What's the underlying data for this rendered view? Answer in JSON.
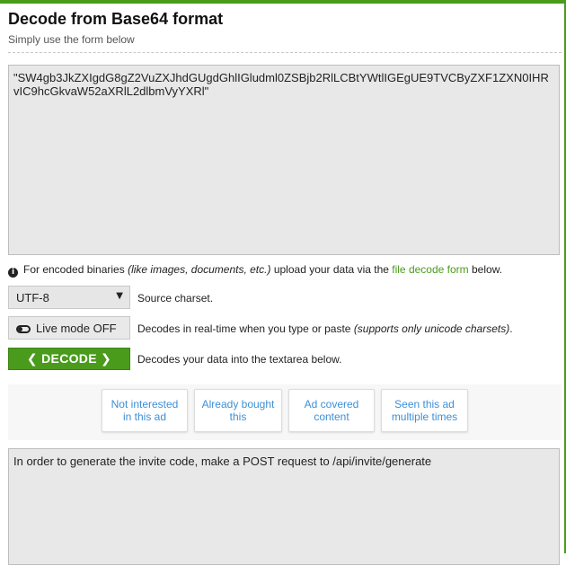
{
  "header": {
    "title": "Decode from Base64 format",
    "subtitle": "Simply use the form below"
  },
  "input": {
    "value": "\"SW4gb3JkZXIgdG8gZ2VuZXJhdGUgdGhlIGludml0ZSBjb2RlLCBtYWtlIGEgUE9TVCByZXF1ZXN0IHRvIC9hcGkvaW52aXRlL2dlbmVyYXRl\""
  },
  "info": {
    "icon": "info-icon",
    "prefix": "For encoded binaries",
    "examples": "(like images, documents, etc.)",
    "middle": "upload your data via the",
    "link": "file decode form",
    "suffix": "below."
  },
  "charset": {
    "selected": "UTF-8",
    "caret": "▼",
    "label": "Source charset."
  },
  "livemode": {
    "button_label": "Live mode OFF",
    "desc": "Decodes in real-time when you type or paste",
    "note": "(supports only unicode charsets)",
    "desc_end": "."
  },
  "decode": {
    "left_chevron": "❮",
    "label": "DECODE",
    "right_chevron": "❯",
    "desc": "Decodes your data into the textarea below."
  },
  "ad_buttons": [
    {
      "label": "Not interested in this ad"
    },
    {
      "label": "Already bought this"
    },
    {
      "label": "Ad covered content"
    },
    {
      "label": "Seen this ad multiple times"
    }
  ],
  "output": {
    "value": "In order to generate the invite code, make a POST request to /api/invite/generate"
  },
  "colors": {
    "accent": "#4a9b1c",
    "link": "#3d8fd6"
  }
}
